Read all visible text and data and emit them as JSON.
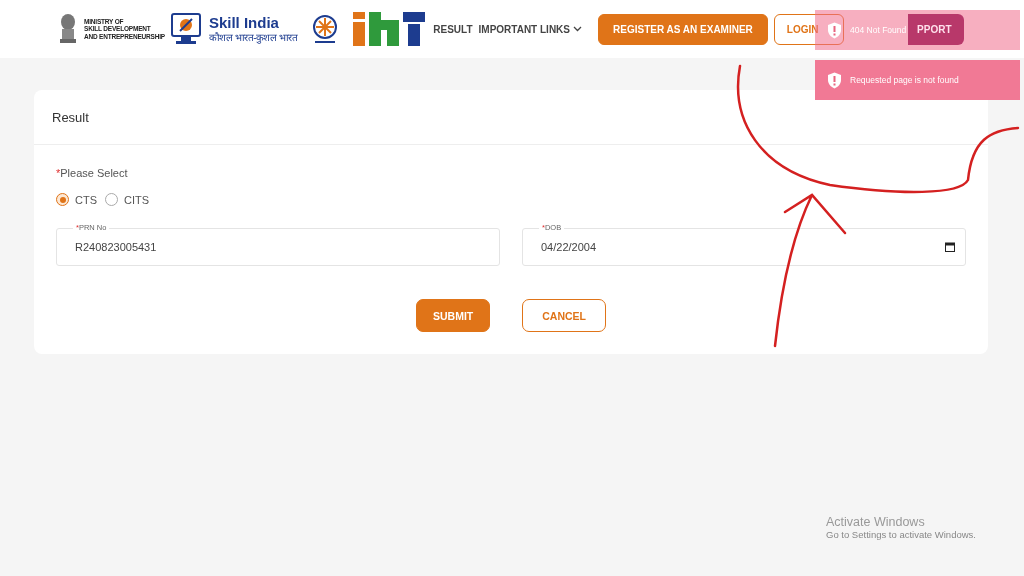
{
  "header": {
    "ministry": {
      "line_1": "MINISTRY OF",
      "line_2": "SKILL DEVELOPMENT",
      "line_3": "AND ENTREPRENEURSHIP"
    },
    "skill_india": {
      "title": "Skill India",
      "tagline": "कौशल भारत-कुशल भारत"
    },
    "nav": [
      {
        "label": "RESULT",
        "kind": "link"
      },
      {
        "label": "IMPORTANT LINKS",
        "kind": "dropdown"
      },
      {
        "label": "REGISTER AS AN EXAMINER",
        "kind": "primary"
      },
      {
        "label": "LOGIN",
        "kind": "outline"
      },
      {
        "label": "PPORT",
        "kind": "covered"
      }
    ]
  },
  "toasts": [
    {
      "message": "404 Not Found"
    },
    {
      "message": "Requested page is not found"
    }
  ],
  "card": {
    "title": "Result",
    "select_label": "Please Select",
    "required_mark": "*",
    "options": [
      {
        "label": "CTS",
        "selected": true
      },
      {
        "label": "CITS",
        "selected": false
      }
    ],
    "fields": [
      {
        "label": "PRN No",
        "value": "R240823005431",
        "kind": "text"
      },
      {
        "label": "DOB",
        "value": "04/22/2004",
        "kind": "date"
      }
    ],
    "buttons": [
      {
        "label": "SUBMIT",
        "kind": "primary"
      },
      {
        "label": "CANCEL",
        "kind": "outline"
      }
    ]
  },
  "os_notice": {
    "title": "Activate Windows",
    "text": "Go to Settings to activate Windows."
  }
}
